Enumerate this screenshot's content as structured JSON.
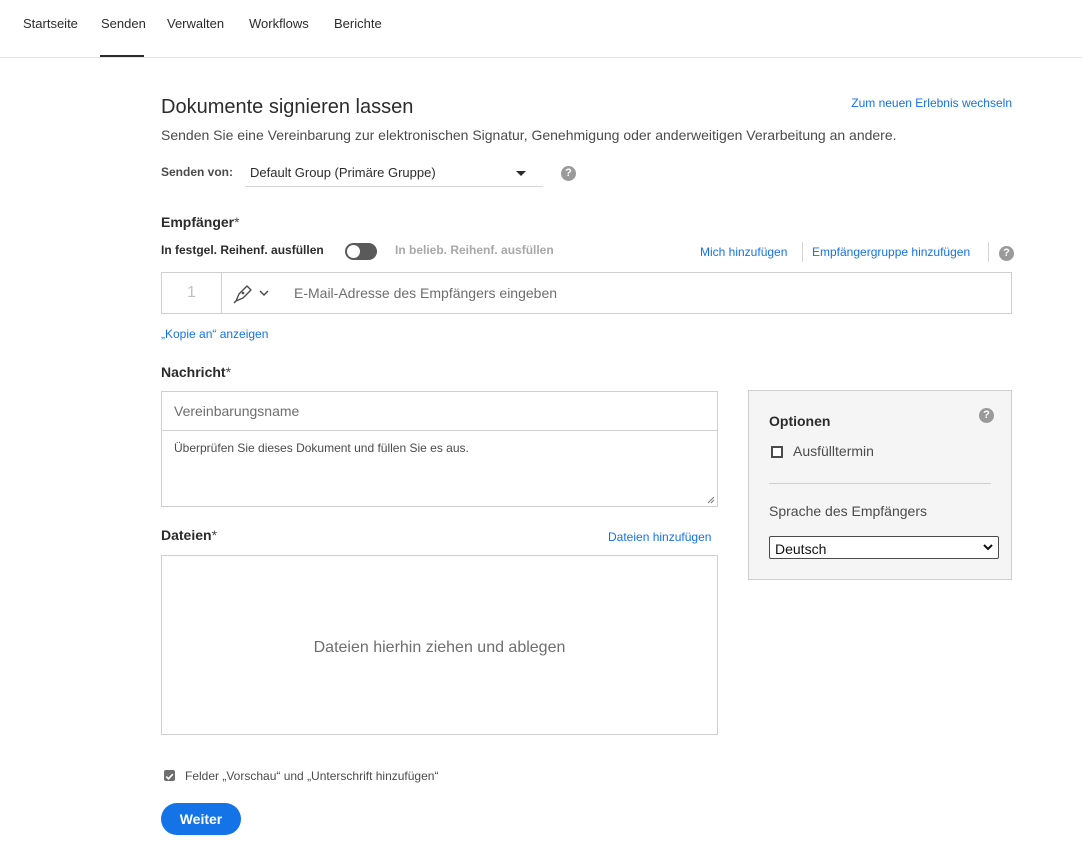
{
  "nav": {
    "items": [
      {
        "label": "Startseite"
      },
      {
        "label": "Senden",
        "active": true
      },
      {
        "label": "Verwalten"
      },
      {
        "label": "Workflows"
      },
      {
        "label": "Berichte"
      }
    ]
  },
  "header": {
    "title": "Dokumente signieren lassen",
    "switch_link": "Zum neuen Erlebnis wechseln",
    "subtitle": "Senden Sie eine Vereinbarung zur elektronischen Signatur, Genehmigung oder anderweitigen Verarbeitung an andere."
  },
  "send_from": {
    "label": "Senden von:",
    "value": "Default Group (Primäre Gruppe)",
    "help": "?"
  },
  "recipients": {
    "label": "Empfänger",
    "required": "*",
    "order_fixed": "In festgel. Reihenf. ausfüllen",
    "order_any": "In belieb. Reihenf. ausfüllen",
    "add_me": "Mich hinzufügen",
    "add_group": "Empfängergruppe hinzufügen",
    "help": "?",
    "row": {
      "number": "1",
      "role_icon": "pen-signer-icon",
      "email_placeholder": "E-Mail-Adresse des Empfängers eingeben"
    },
    "cc_link": "„Kopie an“ anzeigen"
  },
  "message": {
    "label": "Nachricht",
    "required": "*",
    "name_placeholder": "Vereinbarungsname",
    "body_value": "Überprüfen Sie dieses Dokument und füllen Sie es aus."
  },
  "options": {
    "title": "Optionen",
    "help": "?",
    "deadline_label": "Ausfülltermin",
    "deadline_checked": false,
    "lang_label": "Sprache des Empfängers",
    "lang_value": "Deutsch"
  },
  "files": {
    "label": "Dateien",
    "required": "*",
    "add_link": "Dateien hinzufügen",
    "drop_text": "Dateien hierhin ziehen und ablegen"
  },
  "preview": {
    "label": "Felder „Vorschau“ und „Unterschrift hinzufügen“",
    "checked": true
  },
  "next_button": "Weiter",
  "colors": {
    "accent": "#1473e6",
    "text": "#2c2c2c",
    "border": "#cfcfcf"
  }
}
